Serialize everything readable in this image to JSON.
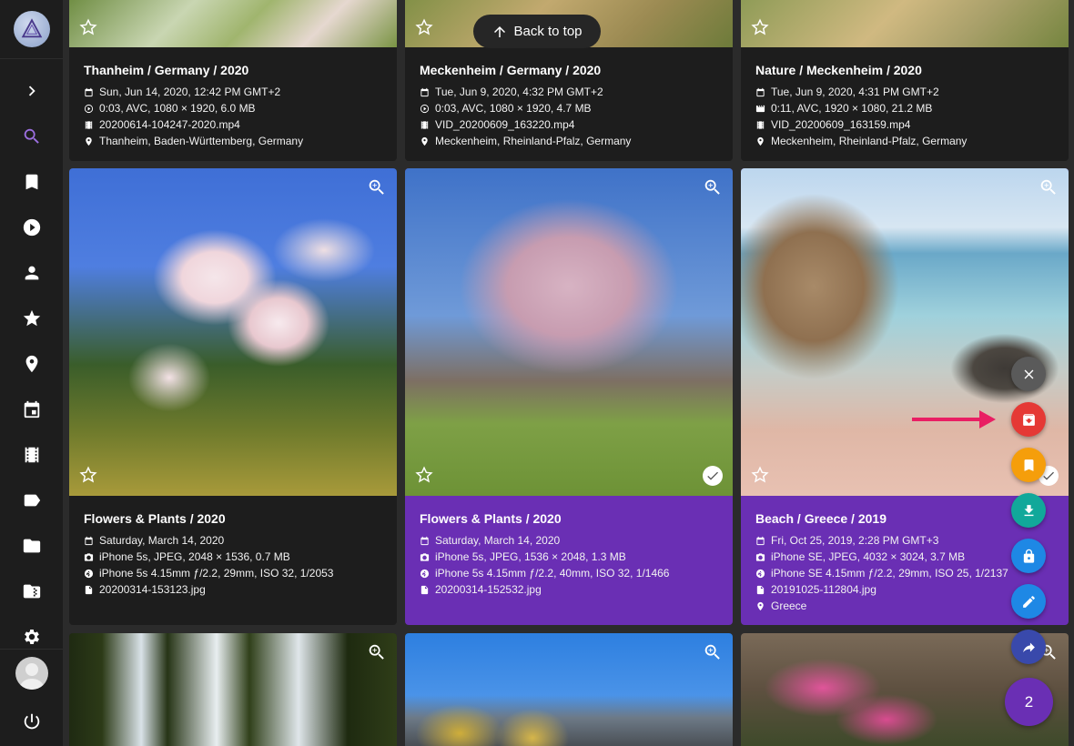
{
  "back_to_top": {
    "label": "Back to top"
  },
  "selection": {
    "count": "2"
  },
  "colors": {
    "accent": "#6a2fb4",
    "archive": "#e53935",
    "bookmark": "#f59e0b",
    "download": "#11a89a",
    "private": "#1e88e5",
    "edit": "#1e88e5",
    "share": "#3949ab",
    "close": "#5a5a5a",
    "arrow": "#e91e63"
  },
  "sidebar": {
    "items": [
      {
        "name": "expand",
        "icon": "chevron-right-icon"
      },
      {
        "name": "search",
        "icon": "search-icon",
        "active": true
      },
      {
        "name": "albums",
        "icon": "bookmark-icon"
      },
      {
        "name": "videos",
        "icon": "play-circle-icon"
      },
      {
        "name": "people",
        "icon": "person-icon"
      },
      {
        "name": "favorites",
        "icon": "star-icon"
      },
      {
        "name": "places",
        "icon": "location-pin-icon"
      },
      {
        "name": "calendar",
        "icon": "calendar-icon"
      },
      {
        "name": "moments",
        "icon": "film-icon"
      },
      {
        "name": "labels",
        "icon": "label-tag-icon"
      },
      {
        "name": "folders",
        "icon": "folder-icon"
      },
      {
        "name": "library",
        "icon": "library-icon"
      },
      {
        "name": "settings",
        "icon": "gear-icon"
      },
      {
        "name": "logout",
        "icon": "power-icon"
      }
    ]
  },
  "cards": [
    {
      "title": "Thanheim / Germany / 2020",
      "rows": [
        {
          "icon": "calendar-icon",
          "text": "Sun, Jun 14, 2020, 12:42 PM GMT+2"
        },
        {
          "icon": "play-circle-icon",
          "text": "0:03, AVC, 1080 × 1920, 6.0 MB"
        },
        {
          "icon": "film-icon",
          "text": "20200614-104247-2020.mp4"
        },
        {
          "icon": "location-pin-icon",
          "text": "Thanheim, Baden-Württemberg, Germany"
        }
      ]
    },
    {
      "title": "Meckenheim / Germany / 2020",
      "rows": [
        {
          "icon": "calendar-icon",
          "text": "Tue, Jun 9, 2020, 4:32 PM GMT+2"
        },
        {
          "icon": "play-circle-icon",
          "text": "0:03, AVC, 1080 × 1920, 4.7 MB"
        },
        {
          "icon": "film-icon",
          "text": "VID_20200609_163220.mp4"
        },
        {
          "icon": "location-pin-icon",
          "text": "Meckenheim, Rheinland-Pfalz, Germany"
        }
      ]
    },
    {
      "title": "Nature / Meckenheim / 2020",
      "rows": [
        {
          "icon": "calendar-icon",
          "text": "Tue, Jun 9, 2020, 4:31 PM GMT+2"
        },
        {
          "icon": "movie-icon",
          "text": "0:11, AVC, 1920 × 1080, 21.2 MB"
        },
        {
          "icon": "film-icon",
          "text": "VID_20200609_163159.mp4"
        },
        {
          "icon": "location-pin-icon",
          "text": "Meckenheim, Rheinland-Pfalz, Germany"
        }
      ]
    },
    {
      "title": "Flowers & Plants / 2020",
      "selected": false,
      "rows": [
        {
          "icon": "calendar-icon",
          "text": "Saturday, March 14, 2020"
        },
        {
          "icon": "camera-icon",
          "text": "iPhone 5s, JPEG, 2048 × 1536, 0.7 MB"
        },
        {
          "icon": "aperture-icon",
          "text": "iPhone 5s 4.15mm ƒ/2.2, 29mm, ISO 32, 1/2053"
        },
        {
          "icon": "file-icon",
          "text": "20200314-153123.jpg"
        }
      ]
    },
    {
      "title": "Flowers & Plants / 2020",
      "selected": true,
      "rows": [
        {
          "icon": "calendar-icon",
          "text": "Saturday, March 14, 2020"
        },
        {
          "icon": "camera-icon",
          "text": "iPhone 5s, JPEG, 1536 × 2048, 1.3 MB"
        },
        {
          "icon": "aperture-icon",
          "text": "iPhone 5s 4.15mm ƒ/2.2, 40mm, ISO 32, 1/1466"
        },
        {
          "icon": "file-icon",
          "text": "20200314-152532.jpg"
        }
      ]
    },
    {
      "title": "Beach / Greece / 2019",
      "selected": true,
      "rows": [
        {
          "icon": "calendar-icon",
          "text": "Fri, Oct 25, 2019, 2:28 PM GMT+3"
        },
        {
          "icon": "camera-icon",
          "text": "iPhone SE, JPEG, 4032 × 3024, 3.7 MB"
        },
        {
          "icon": "aperture-icon",
          "text": "iPhone SE 4.15mm ƒ/2.2, 29mm, ISO 25, 1/2137"
        },
        {
          "icon": "file-icon",
          "text": "20191025-112804.jpg"
        },
        {
          "icon": "location-pin-icon",
          "text": "Greece"
        }
      ]
    }
  ]
}
